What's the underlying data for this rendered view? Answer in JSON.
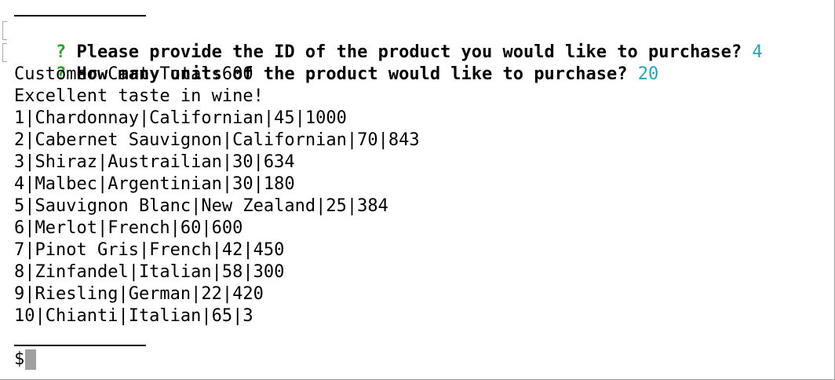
{
  "prompts": [
    {
      "mark": "?",
      "question": " Please provide the ID of the product you would like to purchase? ",
      "answer": "4"
    },
    {
      "mark": "?",
      "question": " How many units of the product would like to purchase? ",
      "answer": "20"
    }
  ],
  "output": {
    "cart_total": "Customer Cart Total:600",
    "message": "Excellent taste in wine!"
  },
  "products": [
    "1|Chardonnay|Californian|45|1000",
    "2|Cabernet Sauvignon|Californian|70|843",
    "3|Shiraz|Austrailian|30|634",
    "4|Malbec|Argentinian|30|180",
    "5|Sauvignon Blanc|New Zealand|25|384",
    "6|Merlot|French|60|600",
    "7|Pinot Gris|French|42|450",
    "8|Zinfandel|Italian|58|300",
    "9|Riesling|German|22|420",
    "10|Chianti|Italian|65|3"
  ],
  "shell": {
    "prompt": "$"
  },
  "colors": {
    "question_mark": "#2e9e2e",
    "answer": "#2aa1b3",
    "cursor": "#a0a0a0"
  }
}
